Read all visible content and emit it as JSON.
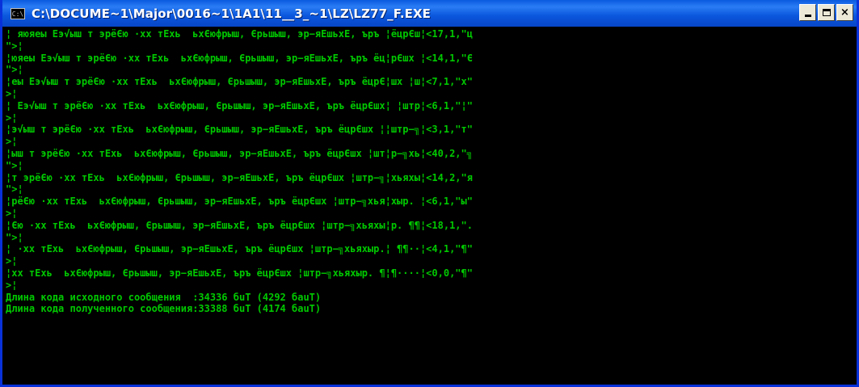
{
  "window": {
    "title": "C:\\DOCUME~1\\Major\\0016~1\\1A1\\11__3_~1\\LZ\\LZ77_F.EXE",
    "icon_label": "C:\\",
    "icon_name": "console-icon",
    "minimize_icon": "minimize-icon",
    "maximize_icon": "maximize-icon",
    "close_label": "×",
    "titlebar_color": "#0a56dc",
    "text_color": "#00c800"
  },
  "console": {
    "lines": [
      "¦ яюяеы Eэ√ыш т эрёЄю ·хх тExь  ьхЄюфрыш, Єрьшыш, эр−яEшьхE, ъръ ¦ёцрЄш¦<17,1,\"ц",
      "\">¦",
      "¦юяеы Eэ√ыш т эрёЄю ·хх тExь  ьхЄюфрыш, Єрьшыш, эр−яEшьхE, ъръ ёц¦рЄшх ¦<14,1,\"Є",
      "\">¦",
      "¦еы Eэ√ыш т эрёЄю ·хх тExь  ьхЄюфрыш, Єрьшыш, эр−яEшьхE, ъръ ёцрЄ¦шх ¦ш¦<7,1,\"х\"",
      ">¦",
      "¦ Eэ√ыш т эрёЄю ·хх тExь  ьхЄюфрыш, Єрьшыш, эр−яEшьхE, ъръ ёцрЄшх¦ ¦штр¦<6,1,\"¦\"",
      ">¦",
      "¦э√ыш т эрёЄю ·хх тExь  ьхЄюфрыш, Єрьшыш, эр−яEшьхE, ъръ ёцрЄшх ¦¦штр−╗¦<3,1,\"т\"",
      ">¦",
      "¦ыш т эрёЄю ·хх тExь  ьхЄюфрыш, Єрьшыш, эр−яEшьхE, ъръ ёцрЄшх ¦шт¦р−╗хь¦<40,2,\"╗",
      "\">¦",
      "¦т эрёЄю ·хх тExь  ьхЄюфрыш, Єрьшыш, эр−яEшьхE, ъръ ёцрЄшх ¦штр−╗¦хьяхы¦<14,2,\"я",
      "\">¦",
      "¦рёЄю ·хх тExь  ьхЄюфрыш, Єрьшыш, эр−яEшьхE, ъръ ёцрЄшх ¦штр−╗хья¦хыр. ¦<6,1,\"ы\"",
      ">¦",
      "¦Єю ·хх тExь  ьхЄюфрыш, Єрьшыш, эр−яEшьхE, ъръ ёцрЄшх ¦штр−╗хьяхы¦р. ¶¶¦<18,1,\".",
      "\">¦",
      "¦ ·хх тExь  ьхЄюфрыш, Єрьшыш, эр−яEшьхE, ъръ ёцрЄшх ¦штр−╗хьяхыр.¦ ¶¶··¦<4,1,\"¶\"",
      ">¦",
      "¦хх тExь  ьхЄюфрыш, Єрьшыш, эр−яEшьхE, ъръ ёцрЄшх ¦штр−╗хьяхыр. ¶¦¶····¦<0,0,\"¶\"",
      ">¦",
      "Длина кода исходного сообщения  :34336 бuT (4292 бauT)",
      "Длина кода полученного сообщения:33388 бuT (4174 бauT)"
    ]
  }
}
